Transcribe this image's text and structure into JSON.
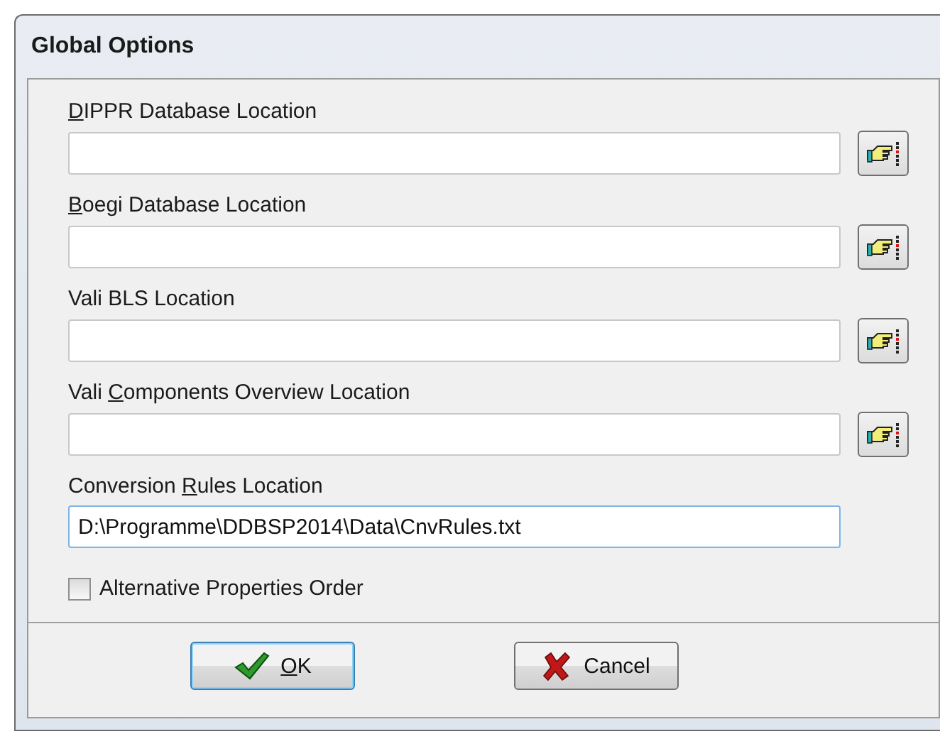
{
  "window": {
    "title": "Global Options"
  },
  "fields": [
    {
      "kind": "browse",
      "mnemonic": "D",
      "label_after": "IPPR Database Location",
      "focused": false
    },
    {
      "kind": "browse",
      "mnemonic": "B",
      "label_after": "oegi Database Location",
      "focused": false
    },
    {
      "kind": "browse",
      "label_before": "Vali BLS Location",
      "focused": false
    },
    {
      "kind": "browse",
      "label_before": "Vali ",
      "mnemonic": "C",
      "label_after": "omponents Overview Location",
      "focused": false
    },
    {
      "kind": "plain",
      "label_before": "Conversion ",
      "mnemonic": "R",
      "label_after": "ules Location",
      "value": "D:\\Programme\\DDBSP2014\\Data\\CnvRules.txt",
      "focused": true
    }
  ],
  "checkbox": {
    "label": "Alternative Properties Order",
    "checked": false
  },
  "buttons": [
    {
      "kind": "ok",
      "mnemonic": "O",
      "label_after": "K",
      "default": true
    },
    {
      "kind": "cancel",
      "label_after": "Cancel",
      "default": false
    }
  ]
}
